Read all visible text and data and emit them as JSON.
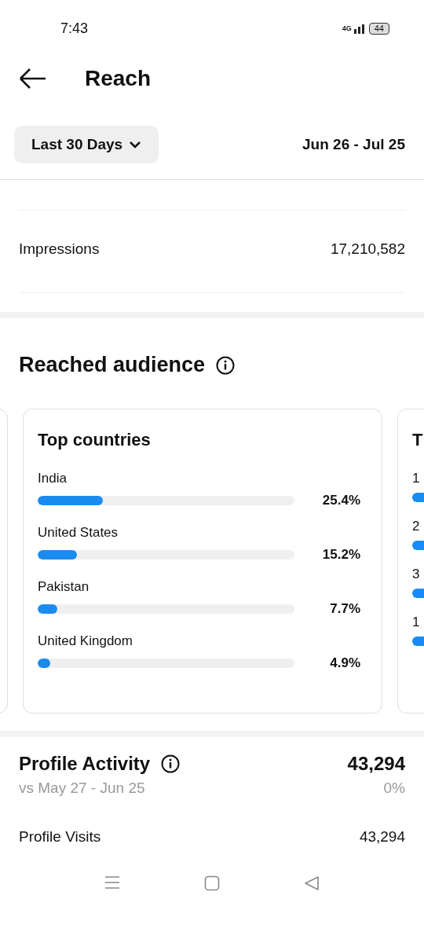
{
  "status_bar": {
    "time": "7:43",
    "network": "4G",
    "battery": "44"
  },
  "header": {
    "title": "Reach"
  },
  "filter": {
    "range": "Last 30 Days",
    "dates": "Jun 26 - Jul 25"
  },
  "impressions": {
    "label": "Impressions",
    "value": "17,210,582"
  },
  "reached_audience": {
    "title": "Reached audience",
    "cards": [
      {
        "title": "Top countries",
        "rows": [
          {
            "label": "India",
            "level": 0.254,
            "value": "25.4%"
          },
          {
            "label": "United States",
            "level": 0.152,
            "value": "15.2%"
          },
          {
            "label": "Pakistan",
            "level": 0.077,
            "value": "7.7%"
          },
          {
            "label": "United Kingdom",
            "level": 0.049,
            "value": "4.9%"
          }
        ]
      },
      {
        "title": "T",
        "rows": [
          {
            "label": "1"
          },
          {
            "label": "2"
          },
          {
            "label": "3"
          },
          {
            "label": "1"
          }
        ]
      }
    ]
  },
  "profile_activity": {
    "title": "Profile Activity",
    "value": "43,294",
    "compare": "vs May 27 - Jun 25",
    "change": "0%",
    "rows": [
      {
        "label": "Profile Visits",
        "value": "43,294"
      }
    ]
  }
}
